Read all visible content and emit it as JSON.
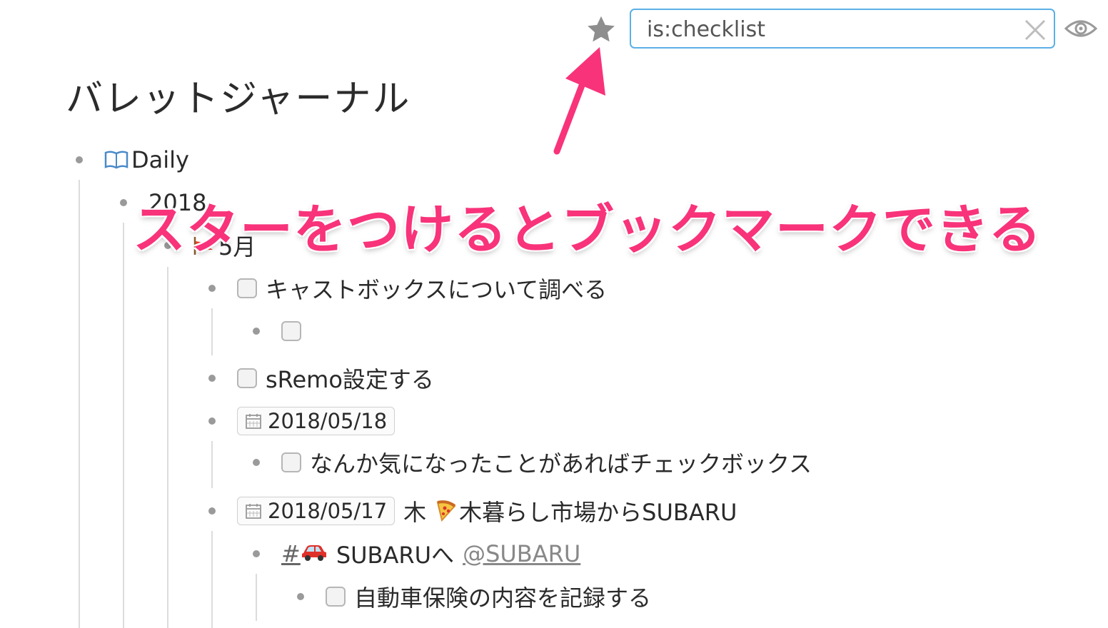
{
  "toolbar": {
    "star_icon": "star-icon",
    "search_value": "is:checklist",
    "clear_icon": "close-icon",
    "eye_icon": "eye-icon"
  },
  "page_title": "バレットジャーナル",
  "annotation": "スターをつけるとブックマークできる",
  "colors": {
    "accent": "#5bb0e6",
    "annotation": "#f8337a",
    "bullet": "#9a9a9a"
  },
  "outline": {
    "daily": "Daily",
    "year_partial": "2018",
    "month": "5月",
    "task1": "キャストボックスについて調べる",
    "task1_child": "",
    "task2": "sRemo設定する",
    "date1": "2018/05/18",
    "date1_child": "なんか気になったことがあればチェックボックス",
    "date2": "2018/05/17",
    "date2_text_prefix": "木",
    "date2_text": "木暮らし市場からSUBARU",
    "tag_hash": "#",
    "tag_text": "SUBARUへ",
    "mention": "@SUBARU",
    "subtask": "自動車保険の内容を記録する"
  }
}
